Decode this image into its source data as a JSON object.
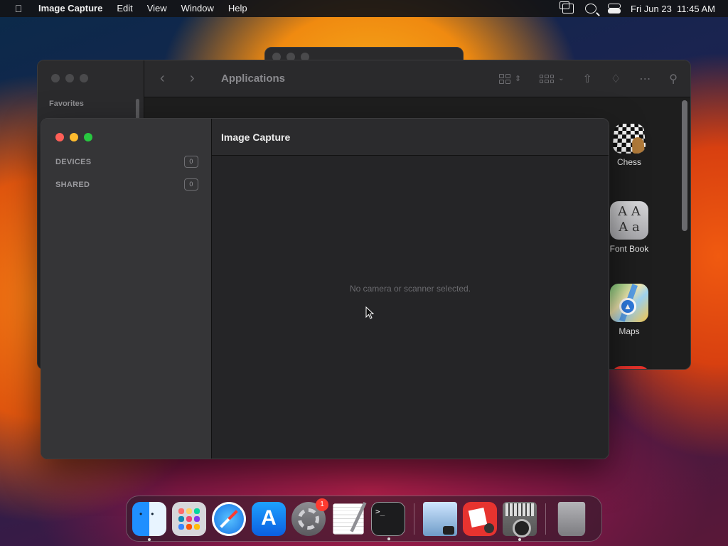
{
  "menubar": {
    "app_name": "Image Capture",
    "items": [
      "Edit",
      "View",
      "Window",
      "Help"
    ],
    "clock": "Fri Jun 23  11:45 AM"
  },
  "finder": {
    "title": "Applications",
    "sidebar_section": "Favorites",
    "apps": [
      {
        "name": "Chess",
        "icon": "chess-icon"
      },
      {
        "name": "Font Book",
        "icon": "font-book-icon",
        "glyph": "A A\nA a"
      },
      {
        "name": "Maps",
        "icon": "maps-icon"
      }
    ]
  },
  "image_capture": {
    "title": "Image Capture",
    "sidebar": [
      {
        "label": "DEVICES",
        "count": "0"
      },
      {
        "label": "SHARED",
        "count": "0"
      }
    ],
    "empty_message": "No camera or scanner selected."
  },
  "dock": {
    "items": [
      {
        "name": "finder",
        "running": true
      },
      {
        "name": "launchpad"
      },
      {
        "name": "safari"
      },
      {
        "name": "app-store"
      },
      {
        "name": "system-settings",
        "badge": "1"
      },
      {
        "name": "textedit"
      },
      {
        "name": "terminal",
        "running": true
      },
      {
        "name": "preview"
      },
      {
        "name": "photo-booth"
      },
      {
        "name": "image-capture",
        "running": true
      },
      {
        "name": "trash"
      }
    ]
  },
  "colors": {
    "close": "#ff5f57",
    "minimize": "#febc2e",
    "zoom": "#28c840"
  }
}
